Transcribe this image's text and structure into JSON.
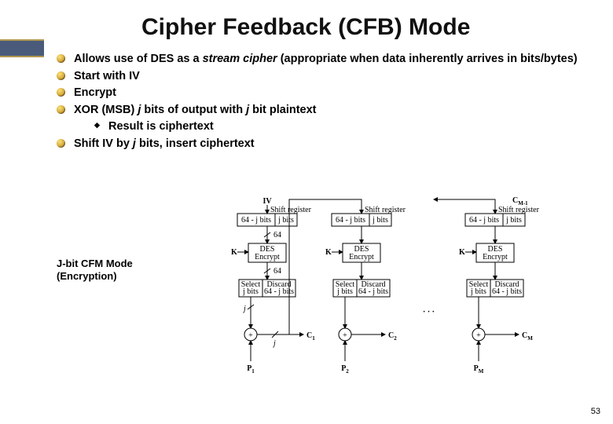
{
  "title": "Cipher Feedback (CFB) Mode",
  "bullets": {
    "b1a": "Allows use of DES as a ",
    "b1b": "stream cipher",
    "b1c": " (appropriate when data inherently arrives in bits/bytes)",
    "b2": "Start with IV",
    "b3": "Encrypt",
    "b4a": "XOR (MSB) ",
    "b4b": "j",
    "b4c": " bits of output with ",
    "b4d": "j",
    "b4e": " bit plaintext",
    "b4s": "Result is ciphertext",
    "b5a": "Shift IV by ",
    "b5b": "j",
    "b5c": " bits, insert ciphertext"
  },
  "caption": {
    "l1": "J-bit CFM Mode",
    "l2": "(Encryption)"
  },
  "diagram": {
    "iv": "IV",
    "cm1": "C",
    "cm1s": "M-1",
    "shift": "Shift register",
    "sr_left": "64 - j bits",
    "sr_right": "j bits",
    "sixtyfour": "64",
    "K": "K",
    "des1": "DES",
    "des2": "Encrypt",
    "sel1": "Select",
    "sel2": "j bits",
    "dis1": "Discard",
    "dis2": "64 - j bits",
    "j": "j",
    "plus": "+",
    "P1": "P",
    "s1": "1",
    "P2": "P",
    "s2": "2",
    "PM": "P",
    "sM": "M",
    "C1": "C",
    "C2": "C",
    "CM": "C"
  },
  "page": "53"
}
